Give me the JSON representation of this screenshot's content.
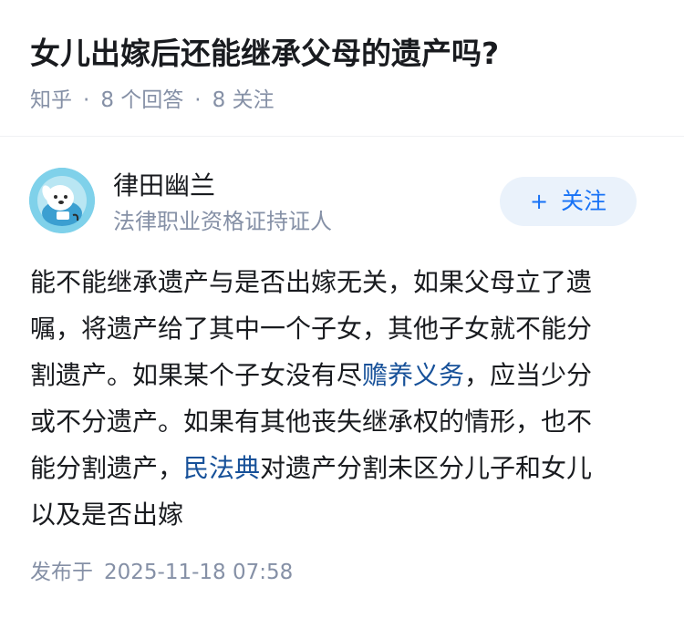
{
  "question": {
    "title": "女儿出嫁后还能继承父母的遗产吗?",
    "source": "知乎",
    "separator": "·",
    "answers_count": "8 个回答",
    "followers_count": "8 关注"
  },
  "author": {
    "name": "律田幽兰",
    "bio": "法律职业资格证持证人",
    "avatar_icon": "dog-cartoon-avatar",
    "follow_label": "关注",
    "follow_icon": "+"
  },
  "answer": {
    "lines": [
      {
        "text": "能不能继承遗产与是否出嫁无关，如果父母立了遗"
      },
      {
        "text": "嘱，将遗产给了其中一个子女，其他子女就不能分"
      },
      {
        "pre": "割遗产。如果某个子女没有尽",
        "link": "赡养义务",
        "post": "，应当少分"
      },
      {
        "text": "或不分遗产。如果有其他丧失继承权的情形，也不"
      },
      {
        "pre": "能分割遗产，",
        "link": "民法典",
        "post": "对遗产分割未区分儿子和女儿"
      },
      {
        "text": "以及是否出嫁"
      }
    ]
  },
  "footer": {
    "published_label": "发布于",
    "published_time": "2025-11-18 07:58"
  },
  "colors": {
    "link": "#175199",
    "accent": "#1772f6",
    "muted": "#8590a6",
    "follow_bg": "#eaf2fb"
  }
}
